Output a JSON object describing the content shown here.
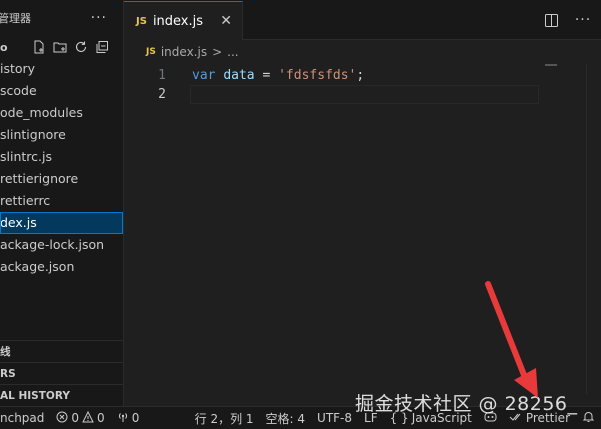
{
  "sidebar": {
    "title": "管理器",
    "more_icon": "ellipsis-icon",
    "folder_label": "o",
    "tools": [
      "new-file-icon",
      "new-folder-icon",
      "refresh-icon",
      "collapse-all-icon"
    ],
    "files": [
      {
        "label": "istory",
        "active": false
      },
      {
        "label": "scode",
        "active": false
      },
      {
        "label": "ode_modules",
        "active": false
      },
      {
        "label": "slintignore",
        "active": false
      },
      {
        "label": "slintrc.js",
        "active": false
      },
      {
        "label": "rettierignore",
        "active": false
      },
      {
        "label": "rettierrc",
        "active": false
      },
      {
        "label": "dex.js",
        "active": true
      },
      {
        "label": "ackage-lock.json",
        "active": false
      },
      {
        "label": "ackage.json",
        "active": false
      }
    ],
    "sections": [
      "线",
      "RS",
      "AL HISTORY"
    ]
  },
  "editor": {
    "tab": {
      "badge": "JS",
      "name": "index.js",
      "close": "✕"
    },
    "actions": [
      "split-editor-icon",
      "more-actions-icon"
    ],
    "breadcrumb": {
      "badge": "JS",
      "file": "index.js",
      "sep": ">",
      "rest": "..."
    },
    "lines": [
      {
        "num": "1",
        "kw": "var",
        "name": "data",
        "op": "=",
        "str": "'fdsfsfds'",
        "end": ";"
      },
      {
        "num": "2"
      }
    ]
  },
  "statusbar": {
    "remote": "nchpad",
    "errors": "0",
    "warnings": "0",
    "ports": "0",
    "position": "行 2，列 1",
    "spaces": "空格: 4",
    "encoding": "UTF-8",
    "eol": "LF",
    "language_braces": "{ }",
    "language": "JavaScript",
    "prettier": "Prettier"
  },
  "watermark": "掘金技术社区 @ 28256_",
  "colors": {
    "accent": "#0078d4",
    "arrow": "#e8393b",
    "js_badge": "#e8c64b"
  }
}
